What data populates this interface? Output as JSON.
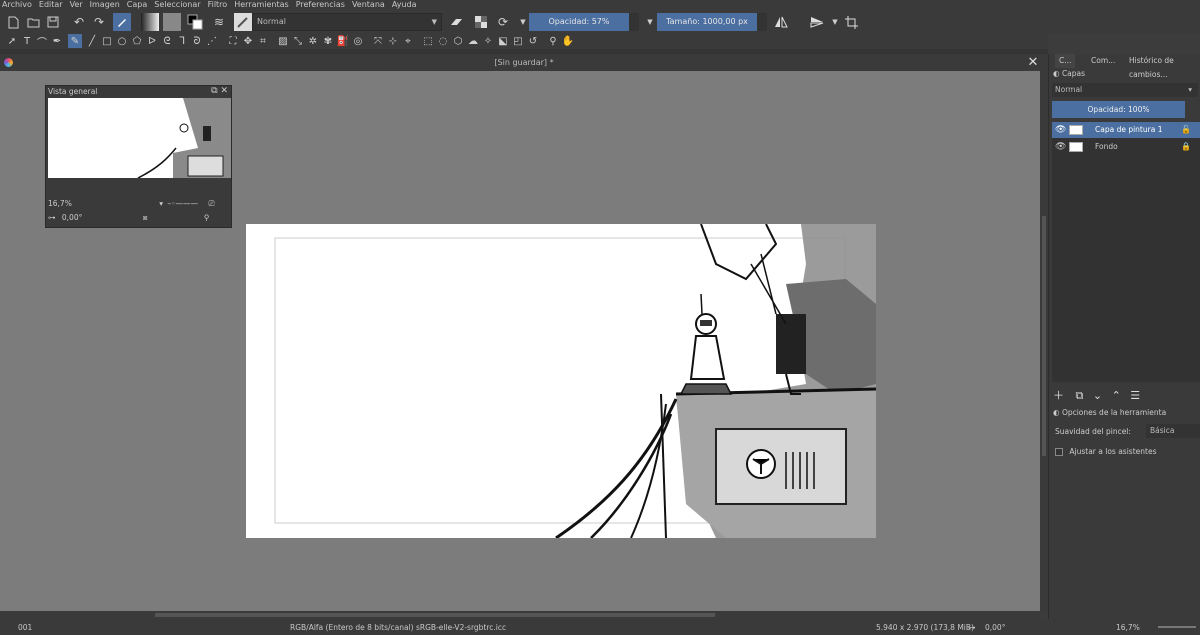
{
  "menu": [
    "Archivo",
    "Editar",
    "Ver",
    "Imagen",
    "Capa",
    "Seleccionar",
    "Filtro",
    "Herramientas",
    "Preferencias",
    "Ventana",
    "Ayuda"
  ],
  "toolbar": {
    "blend_mode": "Normal",
    "opacity": "Opacidad: 57%",
    "size": "Tamaño: 1000,00 px"
  },
  "document": {
    "title": "[Sin guardar]",
    "modified": "*"
  },
  "overview": {
    "title": "Vista general",
    "zoom": "16,7%",
    "rotation": "0,00°"
  },
  "right_dock": {
    "tabs": [
      "C...",
      "Com...",
      "Histórico de cambios..."
    ],
    "layers_title": "Capas",
    "layer_mode": "Normal",
    "layer_opacity": "Opacidad:  100%",
    "layers": [
      {
        "name": "Capa de pintura 1",
        "active": true
      },
      {
        "name": "Fondo",
        "active": false
      }
    ],
    "tool_options_title": "Opciones de la herramienta",
    "smoothing_label": "Suavidad del pincel:",
    "smoothing_value": "Básica",
    "assistants_label": "Ajustar a los asistentes"
  },
  "status": {
    "frame": "001",
    "color_model": "RGB/Alfa (Entero de 8 bits/canal)  sRGB-elle-V2-srgbtrc.icc",
    "dimensions": "5.940 x 2.970 (173,8 MiB)",
    "rotation": "0,00°",
    "zoom": "16,7%"
  },
  "colors": {
    "accent": "#4a6fa0",
    "canvas_bg": "#7c7c7c",
    "panel_bg": "#3a3a3a"
  }
}
